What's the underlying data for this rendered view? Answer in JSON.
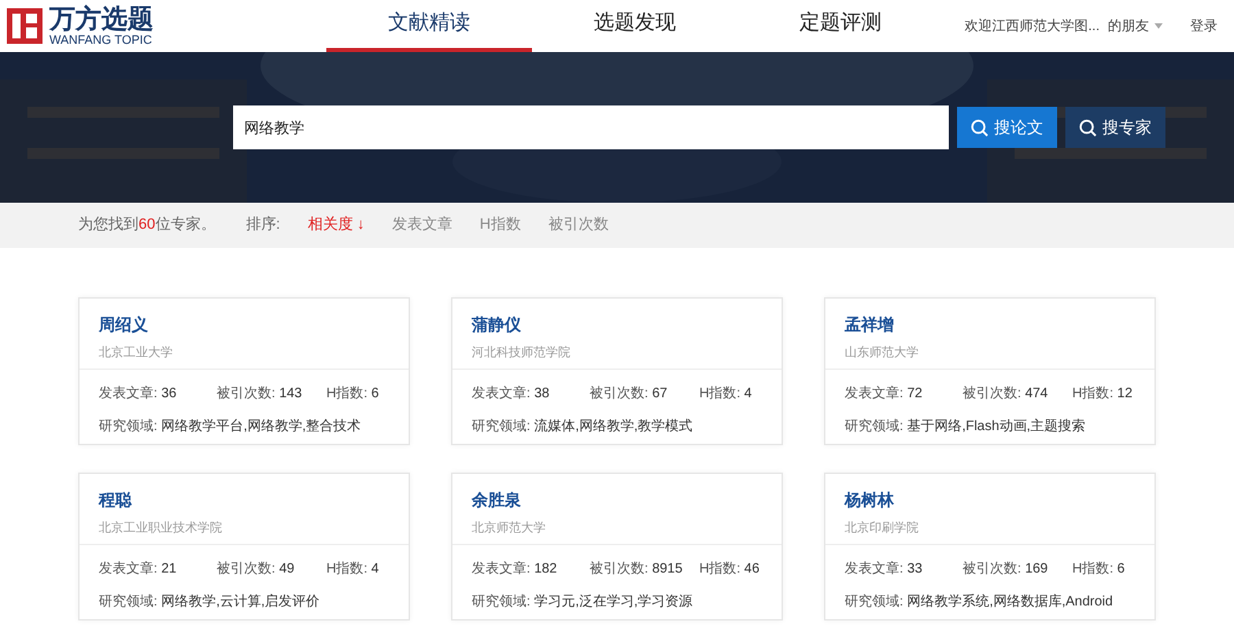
{
  "logo": {
    "title": "万方选题",
    "subtitle": "WANFANG TOPIC"
  },
  "nav": [
    {
      "label": "文献精读",
      "selected": true
    },
    {
      "label": "选题发现",
      "selected": false
    },
    {
      "label": "定题评测",
      "selected": false
    }
  ],
  "user": {
    "welcome": "欢迎江西师范大学图...",
    "name": "的朋友",
    "login": "登录"
  },
  "search": {
    "value": "网络教学",
    "buttons": [
      "搜论文",
      "搜专家"
    ]
  },
  "result": {
    "prefix": "为您找到",
    "count": "60",
    "suffix": "位专家。"
  },
  "sort": {
    "label": "排序:",
    "options": [
      {
        "label": "相关度",
        "selected": true,
        "arrow": "↓"
      },
      {
        "label": "发表文章",
        "selected": false
      },
      {
        "label": "H指数",
        "selected": false
      },
      {
        "label": "被引次数",
        "selected": false
      }
    ]
  },
  "experts": [
    {
      "name": "周绍义",
      "org": "北京工业大学",
      "stats": [
        {
          "label": "发表文章:",
          "value": "36"
        },
        {
          "label": "被引次数:",
          "value": "143"
        },
        {
          "label": "H指数:",
          "value": "6"
        }
      ],
      "field": {
        "label": "研究领域:",
        "value": "网络教学平台,网络教学,整合技术"
      }
    },
    {
      "name": "蒲静仪",
      "org": "河北科技师范学院",
      "stats": [
        {
          "label": "发表文章:",
          "value": "38"
        },
        {
          "label": "被引次数:",
          "value": "67"
        },
        {
          "label": "H指数:",
          "value": "4"
        }
      ],
      "field": {
        "label": "研究领域:",
        "value": "流媒体,网络教学,教学模式"
      }
    },
    {
      "name": "孟祥增",
      "org": "山东师范大学",
      "stats": [
        {
          "label": "发表文章:",
          "value": "72"
        },
        {
          "label": "被引次数:",
          "value": "474"
        },
        {
          "label": "H指数:",
          "value": "12"
        }
      ],
      "field": {
        "label": "研究领域:",
        "value": "基于网络,Flash动画,主题搜索"
      }
    },
    {
      "name": "程聪",
      "org": "北京工业职业技术学院",
      "stats": [
        {
          "label": "发表文章:",
          "value": "21"
        },
        {
          "label": "被引次数:",
          "value": "49"
        },
        {
          "label": "H指数:",
          "value": "4"
        }
      ],
      "field": {
        "label": "研究领域:",
        "value": "网络教学,云计算,启发评价"
      }
    },
    {
      "name": "余胜泉",
      "org": "北京师范大学",
      "stats": [
        {
          "label": "发表文章:",
          "value": "182"
        },
        {
          "label": "被引次数:",
          "value": "8915"
        },
        {
          "label": "H指数:",
          "value": "46"
        }
      ],
      "field": {
        "label": "研究领域:",
        "value": "学习元,泛在学习,学习资源"
      }
    },
    {
      "name": "杨树林",
      "org": "北京印刷学院",
      "stats": [
        {
          "label": "发表文章:",
          "value": "33"
        },
        {
          "label": "被引次数:",
          "value": "169"
        },
        {
          "label": "H指数:",
          "value": "6"
        }
      ],
      "field": {
        "label": "研究领域:",
        "value": "网络教学系统,网络数据库,Android"
      }
    }
  ]
}
